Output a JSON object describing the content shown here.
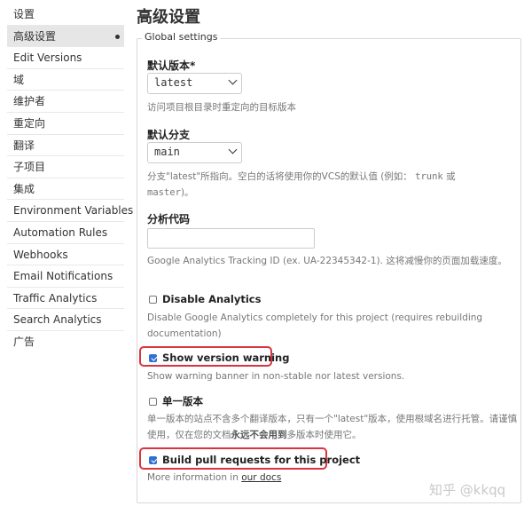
{
  "sidebar": {
    "items": [
      {
        "label": "设置"
      },
      {
        "label": "高级设置",
        "active": true
      },
      {
        "label": "Edit Versions"
      },
      {
        "label": "域"
      },
      {
        "label": "维护者"
      },
      {
        "label": "重定向"
      },
      {
        "label": "翻译"
      },
      {
        "label": "子项目"
      },
      {
        "label": "集成"
      },
      {
        "label": "Environment Variables"
      },
      {
        "label": "Automation Rules"
      },
      {
        "label": "Webhooks"
      },
      {
        "label": "Email Notifications"
      },
      {
        "label": "Traffic Analytics"
      },
      {
        "label": "Search Analytics"
      },
      {
        "label": "广告"
      }
    ]
  },
  "page": {
    "title": "高级设置",
    "legend": "Global settings"
  },
  "form": {
    "default_version": {
      "label": "默认版本*",
      "value": "latest",
      "help": "访问项目根目录时重定向的目标版本"
    },
    "default_branch": {
      "label": "默认分支",
      "value": "main",
      "help_1": "分支\"latest\"所指向。空白的话将使用你的VCS的默认值 (例如：",
      "help_code_1": "trunk",
      "help_2": "或",
      "help_code_2": "master",
      "help_3": ")。"
    },
    "analytics_code": {
      "label": "分析代码",
      "value": "",
      "help": "Google Analytics Tracking ID (ex. UA-22345342-1). 这将减慢你的页面加载速度。"
    },
    "disable_analytics": {
      "label": "Disable Analytics",
      "checked": false,
      "help": "Disable Google Analytics completely for this project (requires rebuilding documentation)"
    },
    "show_version_warning": {
      "label": "Show version warning",
      "checked": true,
      "help": "Show warning banner in non-stable nor latest versions."
    },
    "single_version": {
      "label": "单一版本",
      "checked": false,
      "help_1": "单一版本的站点不含多个翻译版本，只有一个\"latest\"版本，使用根域名进行托管。请谨慎使用，仅在您的文档",
      "help_bold": "永远不会用到",
      "help_2": "多版本时使用它。"
    },
    "build_pull_requests": {
      "label": "Build pull requests for this project",
      "checked": true,
      "help_prefix": "More information in ",
      "help_link": "our docs"
    }
  },
  "watermark": "知乎 @kkqq",
  "colors": {
    "highlight": "#d9343f",
    "checkbox_checked": "#2f6fd6",
    "active_sidebar": "#e6e6e6"
  }
}
